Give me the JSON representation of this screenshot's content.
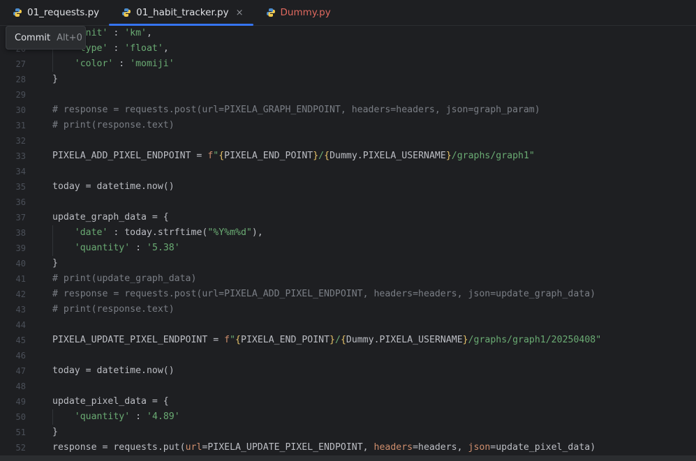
{
  "tabs": [
    {
      "label": "01_requests.py",
      "active": false,
      "error": false
    },
    {
      "label": "01_habit_tracker.py",
      "active": true,
      "error": false,
      "close": "×"
    },
    {
      "label": "Dummy.py",
      "active": false,
      "error": true
    }
  ],
  "tooltip": {
    "label": "Commit",
    "shortcut": "Alt+0"
  },
  "lines": [
    {
      "n": "25",
      "html": "    <span class=\"c-str\">'unit'</span> : <span class=\"c-str\">'km'</span>,"
    },
    {
      "n": "26",
      "html": "    <span class=\"c-str\">'type'</span> : <span class=\"c-str\">'float'</span>,"
    },
    {
      "n": "27",
      "html": "    <span class=\"c-str\">'color'</span> : <span class=\"c-str\">'momiji'</span>"
    },
    {
      "n": "28",
      "html": "}"
    },
    {
      "n": "29",
      "html": ""
    },
    {
      "n": "30",
      "html": "<span class=\"c-com\"># response = requests.post(url=PIXELA_GRAPH_ENDPOINT, headers=headers, json=graph_param)</span>"
    },
    {
      "n": "31",
      "html": "<span class=\"c-com\"># print(response.text)</span>"
    },
    {
      "n": "32",
      "html": ""
    },
    {
      "n": "33",
      "html": "PIXELA_ADD_PIXEL_ENDPOINT = <span class=\"c-kw\">f</span><span class=\"c-str\">\"</span><span class=\"c-br\">{</span>PIXELA_END_POINT<span class=\"c-br\">}</span><span class=\"c-str\">/</span><span class=\"c-br\">{</span>Dummy.PIXELA_USERNAME<span class=\"c-br\">}</span><span class=\"c-str\">/graphs/graph1\"</span>"
    },
    {
      "n": "34",
      "html": ""
    },
    {
      "n": "35",
      "html": "today = datetime.now()"
    },
    {
      "n": "36",
      "html": ""
    },
    {
      "n": "37",
      "html": "update_graph_data = {"
    },
    {
      "n": "38",
      "html": "    <span class=\"c-str\">'date'</span> : today.strftime(<span class=\"c-str\">\"%Y%m%d\"</span>),"
    },
    {
      "n": "39",
      "html": "    <span class=\"c-str\">'quantity'</span> : <span class=\"c-str\">'5.38'</span>"
    },
    {
      "n": "40",
      "html": "}"
    },
    {
      "n": "41",
      "html": "<span class=\"c-com\"># print(update_graph_data)</span>"
    },
    {
      "n": "42",
      "html": "<span class=\"c-com\"># response = requests.post(url=PIXELA_ADD_PIXEL_ENDPOINT, headers=headers, json=update_graph_data)</span>"
    },
    {
      "n": "43",
      "html": "<span class=\"c-com\"># print(response.text)</span>"
    },
    {
      "n": "44",
      "html": ""
    },
    {
      "n": "45",
      "html": "PIXELA_UPDATE_PIXEL_ENDPOINT = <span class=\"c-kw\">f</span><span class=\"c-str\">\"</span><span class=\"c-br\">{</span>PIXELA_END_POINT<span class=\"c-br\">}</span><span class=\"c-str\">/</span><span class=\"c-br\">{</span>Dummy.PIXELA_USERNAME<span class=\"c-br\">}</span><span class=\"c-str\">/graphs/graph1/20250408\"</span>"
    },
    {
      "n": "46",
      "html": ""
    },
    {
      "n": "47",
      "html": "today = datetime.now()"
    },
    {
      "n": "48",
      "html": ""
    },
    {
      "n": "49",
      "html": "update_pixel_data = {"
    },
    {
      "n": "50",
      "html": "    <span class=\"c-str\">'quantity'</span> : <span class=\"c-str\">'4.89'</span>"
    },
    {
      "n": "51",
      "html": "}"
    },
    {
      "n": "52",
      "html": "response = requests.put(<span class=\"c-par\">url</span>=PIXELA_UPDATE_PIXEL_ENDPOINT, <span class=\"c-par\">headers</span>=headers, <span class=\"c-par\">json</span>=update_pixel_data)"
    }
  ],
  "colors": {
    "background": "#1e1f22",
    "accent": "#3574f0",
    "string": "#6aab73",
    "comment": "#7a7e85",
    "keyword": "#cf8e6d",
    "error_tab": "#e0695f"
  }
}
